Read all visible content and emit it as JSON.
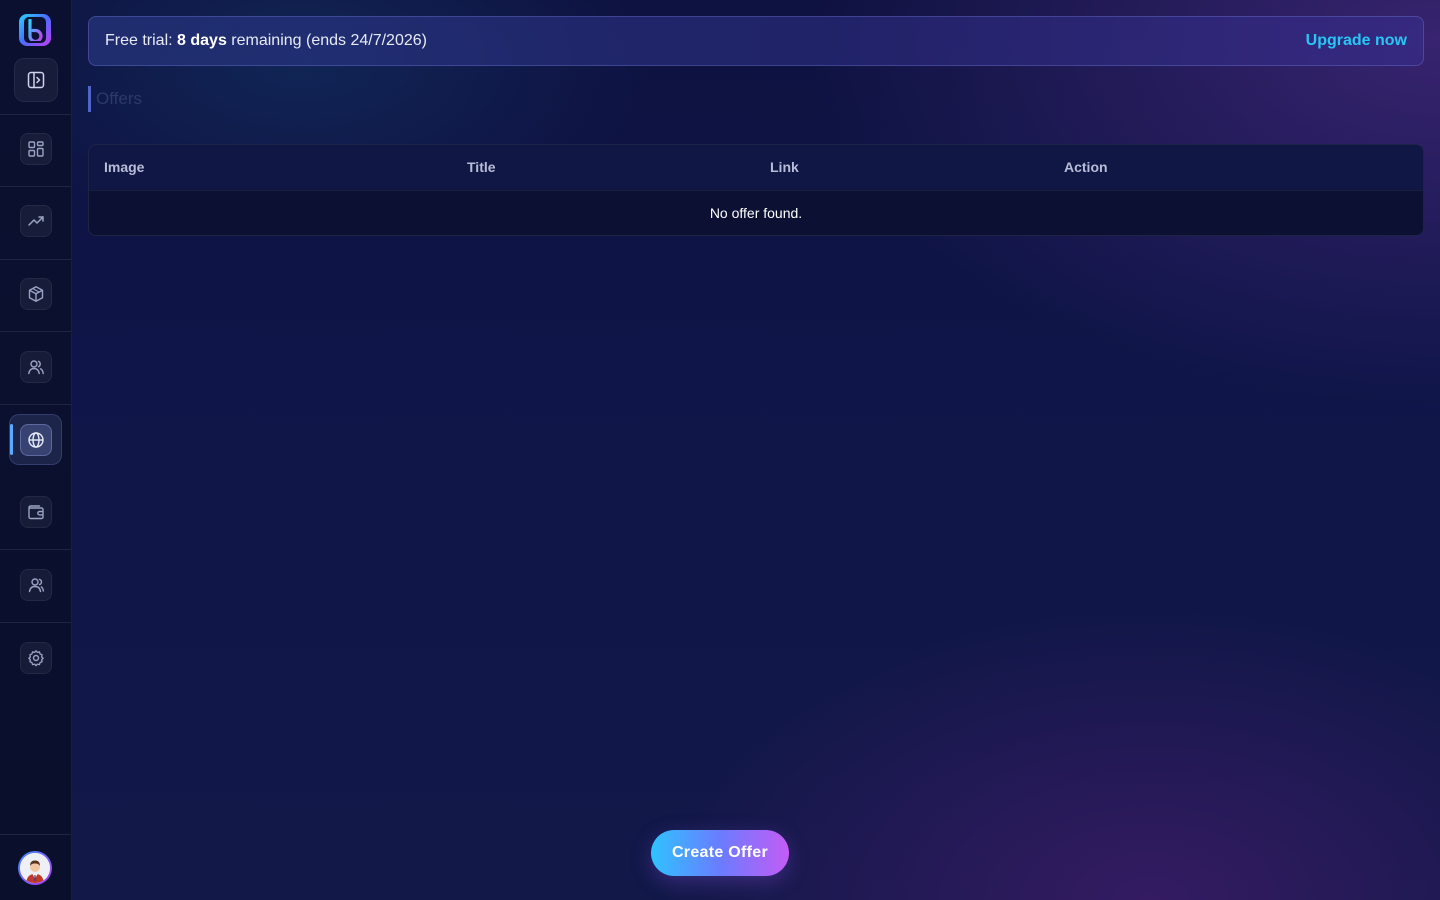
{
  "banner": {
    "prefix": "Free trial:",
    "days": "8 days",
    "suffix": "remaining (ends 24/7/2026)",
    "upgrade_label": "Upgrade now"
  },
  "page": {
    "title": "Offers"
  },
  "table": {
    "columns": [
      "Image",
      "Title",
      "Link",
      "Action"
    ],
    "empty_message": "No offer found."
  },
  "actions": {
    "create_label": "Create Offer"
  },
  "sidebar": {
    "items": [
      {
        "icon": "dashboard-icon"
      },
      {
        "icon": "analytics-icon"
      },
      {
        "icon": "products-icon"
      },
      {
        "icon": "users-icon"
      },
      {
        "icon": "globe-icon",
        "active": true
      },
      {
        "icon": "wallet-icon"
      },
      {
        "icon": "team-icon"
      },
      {
        "icon": "settings-icon"
      }
    ]
  },
  "colors": {
    "accent": "#27c6f5",
    "active_indicator": "#5aa8ff"
  }
}
